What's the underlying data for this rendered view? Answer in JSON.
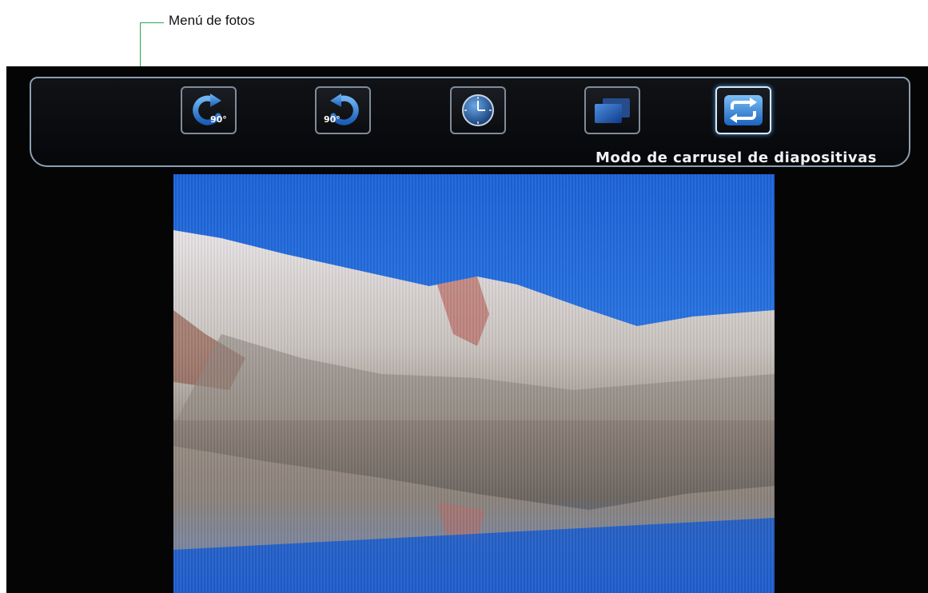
{
  "annotation": {
    "label": "Menú de fotos"
  },
  "photo_menu": {
    "buttons": [
      {
        "name": "rotate-clockwise-90",
        "icon": "rotate-clockwise-icon",
        "text": "90°"
      },
      {
        "name": "rotate-counterclockwise-90",
        "icon": "rotate-counterclockwise-icon",
        "text": "90°"
      },
      {
        "name": "clock",
        "icon": "clock-icon"
      },
      {
        "name": "slideshow-effect",
        "icon": "stacked-slides-icon"
      },
      {
        "name": "carousel-mode",
        "icon": "repeat-icon",
        "selected": true
      }
    ],
    "selected_label": "Modo de carrusel de diapositivas"
  },
  "colors": {
    "accent": "#1e6fd0",
    "menu_border": "#8a9fb2",
    "callout_line": "#2aa84a"
  }
}
